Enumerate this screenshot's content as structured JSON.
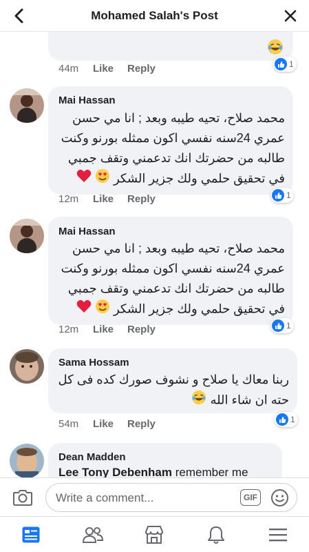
{
  "header": {
    "title": "Mohamed Salah's Post"
  },
  "comments": [
    {
      "time": "44m",
      "like": "Like",
      "reply": "Reply",
      "reactions": "1"
    },
    {
      "author": "Mai Hassan",
      "lines": [
        "محمد صلاح، تحيه طيبه وبعد ; انا مي حسن",
        "عمري 24سنه نفسي اكون ممثله بورنو وكنت",
        "طالبه من حضرتك انك تدعمني وتقف جمبي",
        "في تحقيق حلمي ولك جزير الشكر"
      ],
      "time": "12m",
      "like": "Like",
      "reply": "Reply",
      "reactions": "1"
    },
    {
      "author": "Mai Hassan",
      "lines": [
        "محمد صلاح، تحيه طيبه وبعد ; انا مي حسن",
        "عمري 24سنه نفسي اكون ممثله بورنو وكنت",
        "طالبه من حضرتك انك تدعمني وتقف جمبي",
        "في تحقيق حلمي ولك جزير الشكر"
      ],
      "time": "12m",
      "like": "Like",
      "reply": "Reply",
      "reactions": "1"
    },
    {
      "author": "Sama Hossam",
      "lines": [
        "ربنا معاك يا صلاح و نشوف صورك كده فى كل",
        "حته ان شاء الله"
      ],
      "time": "54m",
      "like": "Like",
      "reply": "Reply",
      "reactions": "1"
    },
    {
      "author": "Dean Madden",
      "mention": "Lee Tony Debenham",
      "text": "remember me"
    }
  ],
  "composer": {
    "placeholder": "Write a comment...",
    "gif_label": "GIF"
  },
  "tabs": [
    {
      "icon": "news-feed-icon",
      "active": true
    },
    {
      "icon": "friends-icon",
      "active": false
    },
    {
      "icon": "marketplace-icon",
      "active": false
    },
    {
      "icon": "notifications-icon",
      "active": false
    },
    {
      "icon": "menu-icon",
      "active": false
    }
  ],
  "colors": {
    "accent": "#1877f2",
    "bubble": "#f0f2f5",
    "muted": "#65676b",
    "heart": "#e41e3f"
  }
}
